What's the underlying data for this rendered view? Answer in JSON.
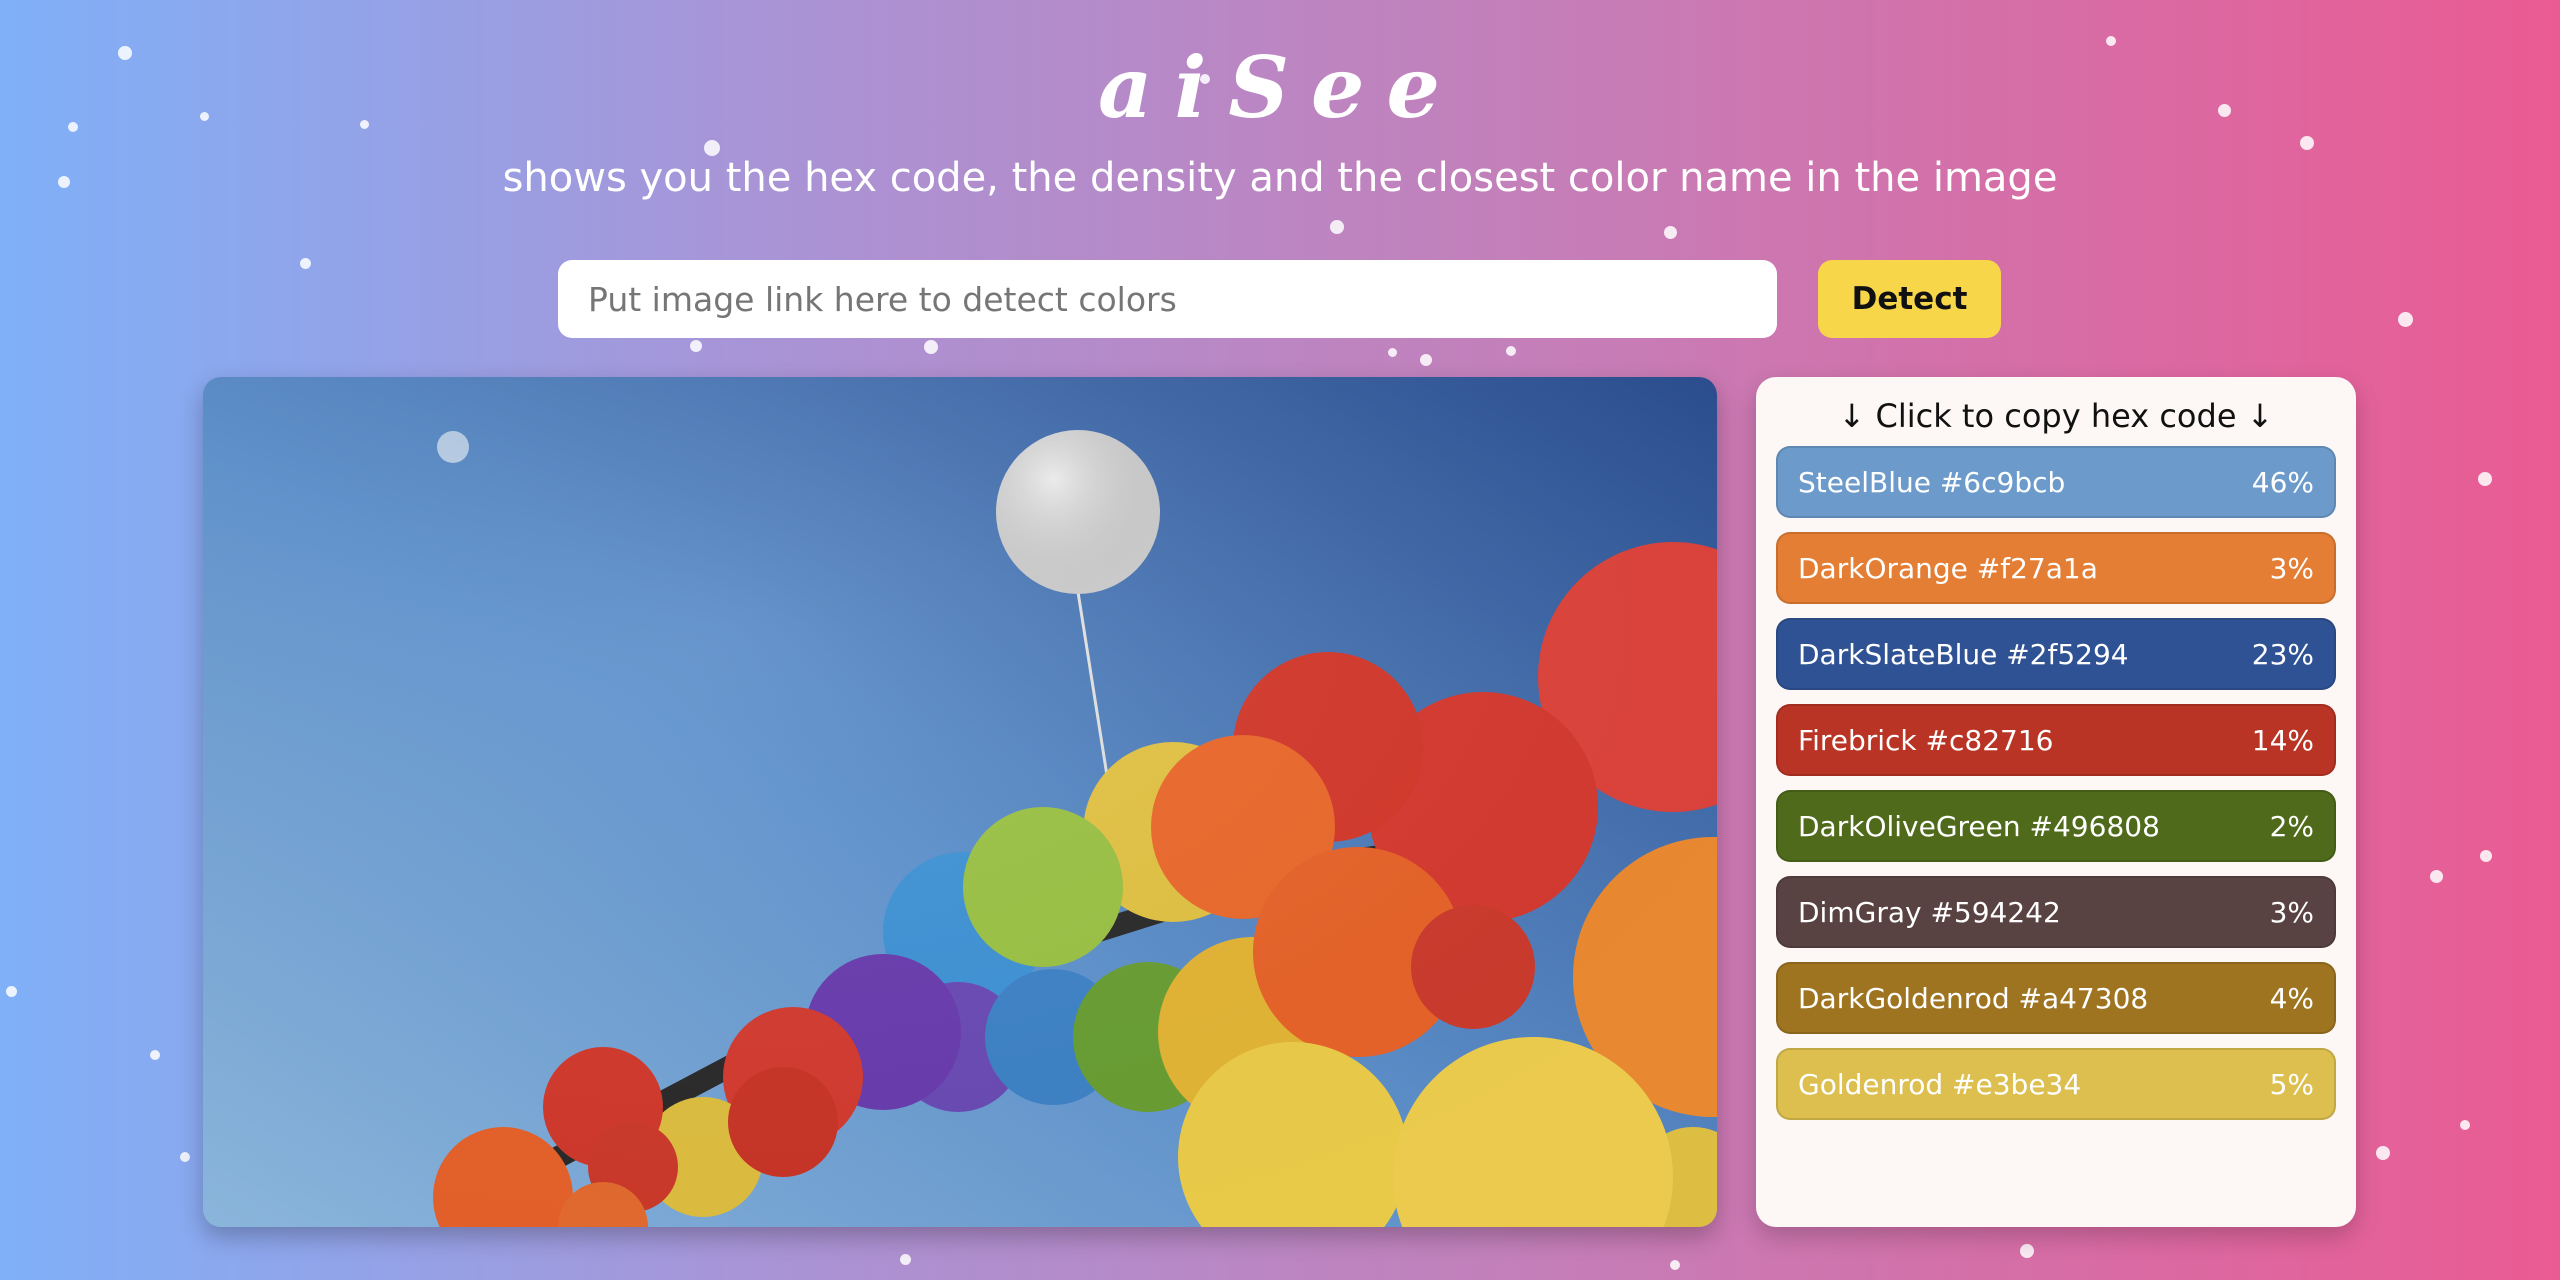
{
  "header": {
    "logo": "aiSee",
    "subtitle": "shows you the hex code, the density and the closest color name in the image"
  },
  "search": {
    "placeholder": "Put image link here to detect colors",
    "value": "",
    "button_label": "Detect"
  },
  "image": {
    "subject": "rainbow balloons against blue sky"
  },
  "palette": {
    "title": "↓ Click to copy hex code ↓",
    "colors": [
      {
        "name": "SteelBlue",
        "hex": "#6c9bcb",
        "label": "SteelBlue #6c9bcb",
        "percent": "46%",
        "value": 46
      },
      {
        "name": "DarkOrange",
        "hex": "#f27a1a",
        "label": "DarkOrange #f27a1a",
        "percent": "3%",
        "value": 3
      },
      {
        "name": "DarkSlateBlue",
        "hex": "#2f5294",
        "label": "DarkSlateBlue #2f5294",
        "percent": "23%",
        "value": 23
      },
      {
        "name": "Firebrick",
        "hex": "#c82716",
        "label": "Firebrick #c82716",
        "percent": "14%",
        "value": 14
      },
      {
        "name": "DarkOliveGreen",
        "hex": "#496808",
        "label": "DarkOliveGreen #496808",
        "percent": "2%",
        "value": 2
      },
      {
        "name": "DimGray",
        "hex": "#594242",
        "label": "DimGray #594242",
        "percent": "3%",
        "value": 3
      },
      {
        "name": "DarkGoldenrod",
        "hex": "#a47308",
        "label": "DarkGoldenrod #a47308",
        "percent": "4%",
        "value": 4
      },
      {
        "name": "Goldenrod",
        "hex": "#e3be34",
        "label": "Goldenrod #e3be34",
        "percent": "5%",
        "value": 5
      }
    ]
  }
}
